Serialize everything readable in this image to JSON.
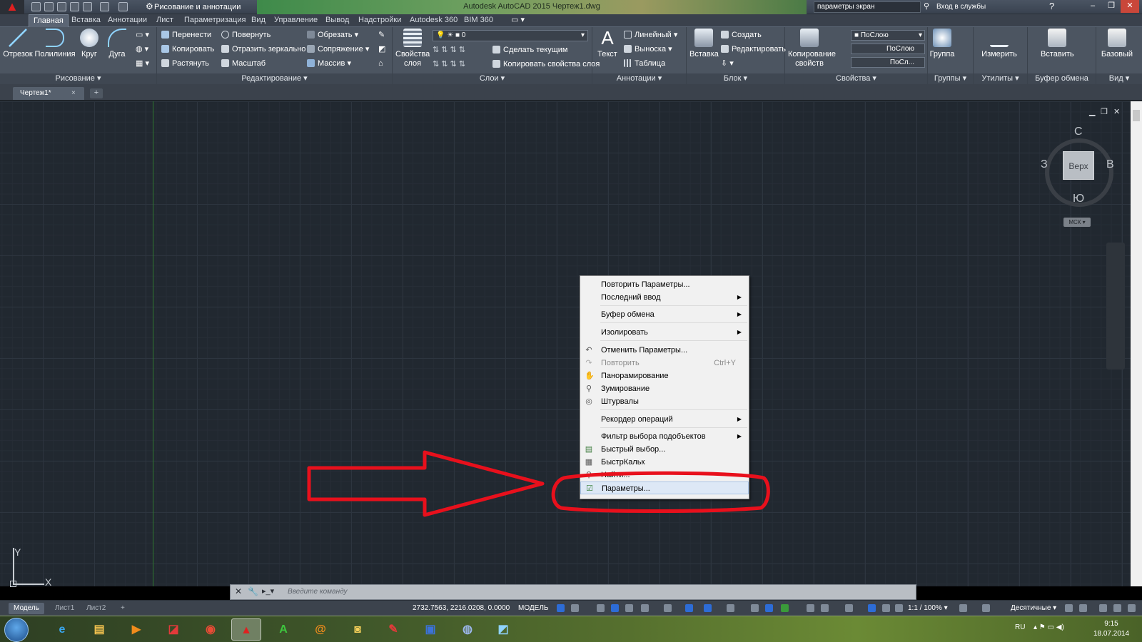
{
  "window": {
    "app_title": "Autodesk AutoCAD 2015    Чертеж1.dwg",
    "workspace": "Рисование и аннотации",
    "search_value": "параметры экран",
    "login": "Вход в службы",
    "help": "?"
  },
  "ribbon_tabs": [
    "Главная",
    "Вставка",
    "Аннотации",
    "Лист",
    "Параметризация",
    "Вид",
    "Управление",
    "Вывод",
    "Надстройки",
    "Autodesk 360",
    "BIM 360"
  ],
  "ribbon": {
    "draw": {
      "title": "Рисование ▾",
      "line": "Отрезок",
      "polyline": "Полилиния",
      "circle": "Круг",
      "arc": "Дуга"
    },
    "modify": {
      "title": "Редактирование ▾",
      "move": "Перенести",
      "rotate": "Повернуть",
      "trim": "Обрезать ▾",
      "copy": "Копировать",
      "mirror": "Отразить зеркально",
      "fillet": "Сопряжение ▾",
      "stretch": "Растянуть",
      "scale": "Масштаб",
      "array": "Массив ▾"
    },
    "layers": {
      "title": "Слои ▾",
      "props_label": "Свойства слоя",
      "layer_value": "0",
      "make_current": "Сделать текущим",
      "match_layer": "Копировать свойства слоя"
    },
    "annotation": {
      "title": "Аннотации ▾",
      "text": "Текст",
      "linear": "Линейный ▾",
      "leader": "Выноска ▾",
      "table": "Таблица"
    },
    "block": {
      "title": "Блок ▾",
      "insert": "Вставка",
      "create": "Создать",
      "edit": "Редактировать"
    },
    "properties": {
      "title": "Свойства ▾",
      "match": "Копирование свойств",
      "color": "ПоСлою",
      "linetype": "ПоСлою",
      "lineweight": "ПоСл..."
    },
    "groups": {
      "title": "Группы ▾",
      "group": "Группа"
    },
    "utilities": {
      "title": "Утилиты ▾",
      "measure": "Измерить"
    },
    "clipboard": {
      "title": "Буфер обмена",
      "paste": "Вставить"
    },
    "view": {
      "title": "Вид ▾",
      "base": "Базовый"
    }
  },
  "file_tab": {
    "name": "Чертеж1*",
    "close": "×",
    "new": "+"
  },
  "viewcube": {
    "top": "Верх",
    "north": "С",
    "south": "Ю",
    "east": "В",
    "west": "З",
    "ucs": "МСК ▾"
  },
  "ucs_icon": {
    "x": "X",
    "y": "Y"
  },
  "context_menu": {
    "items": [
      {
        "label": "Повторить Параметры..."
      },
      {
        "label": "Последний ввод"
      },
      {
        "label": "Буфер обмена"
      },
      {
        "label": "Изолировать"
      },
      {
        "label": "Отменить Параметры..."
      },
      {
        "label": "Повторить",
        "shortcut": "Ctrl+Y"
      },
      {
        "label": "Панорамирование"
      },
      {
        "label": "Зумирование"
      },
      {
        "label": "Штурвалы"
      },
      {
        "label": "Рекордер операций"
      },
      {
        "label": "Фильтр выбора подобъектов"
      },
      {
        "label": "Быстрый выбор..."
      },
      {
        "label": "БыстрКальк"
      },
      {
        "label": "Найти..."
      },
      {
        "label": "Параметры..."
      }
    ]
  },
  "command_line": {
    "placeholder": "Введите команду"
  },
  "layout_tabs": [
    "Модель",
    "Лист1",
    "Лист2"
  ],
  "status": {
    "coordinates": "2732.7563, 2216.0208, 0.0000",
    "model": "МОДЕЛЬ",
    "scale": "1:1 / 100% ▾",
    "units": "Десятичные ▾"
  },
  "taskbar": {
    "language": "RU",
    "time": "9:15",
    "date": "18.07.2014"
  },
  "colors": {
    "annotation_red": "#e8101c",
    "canvas": "#212830",
    "menu_bg": "#f1f1f1"
  }
}
